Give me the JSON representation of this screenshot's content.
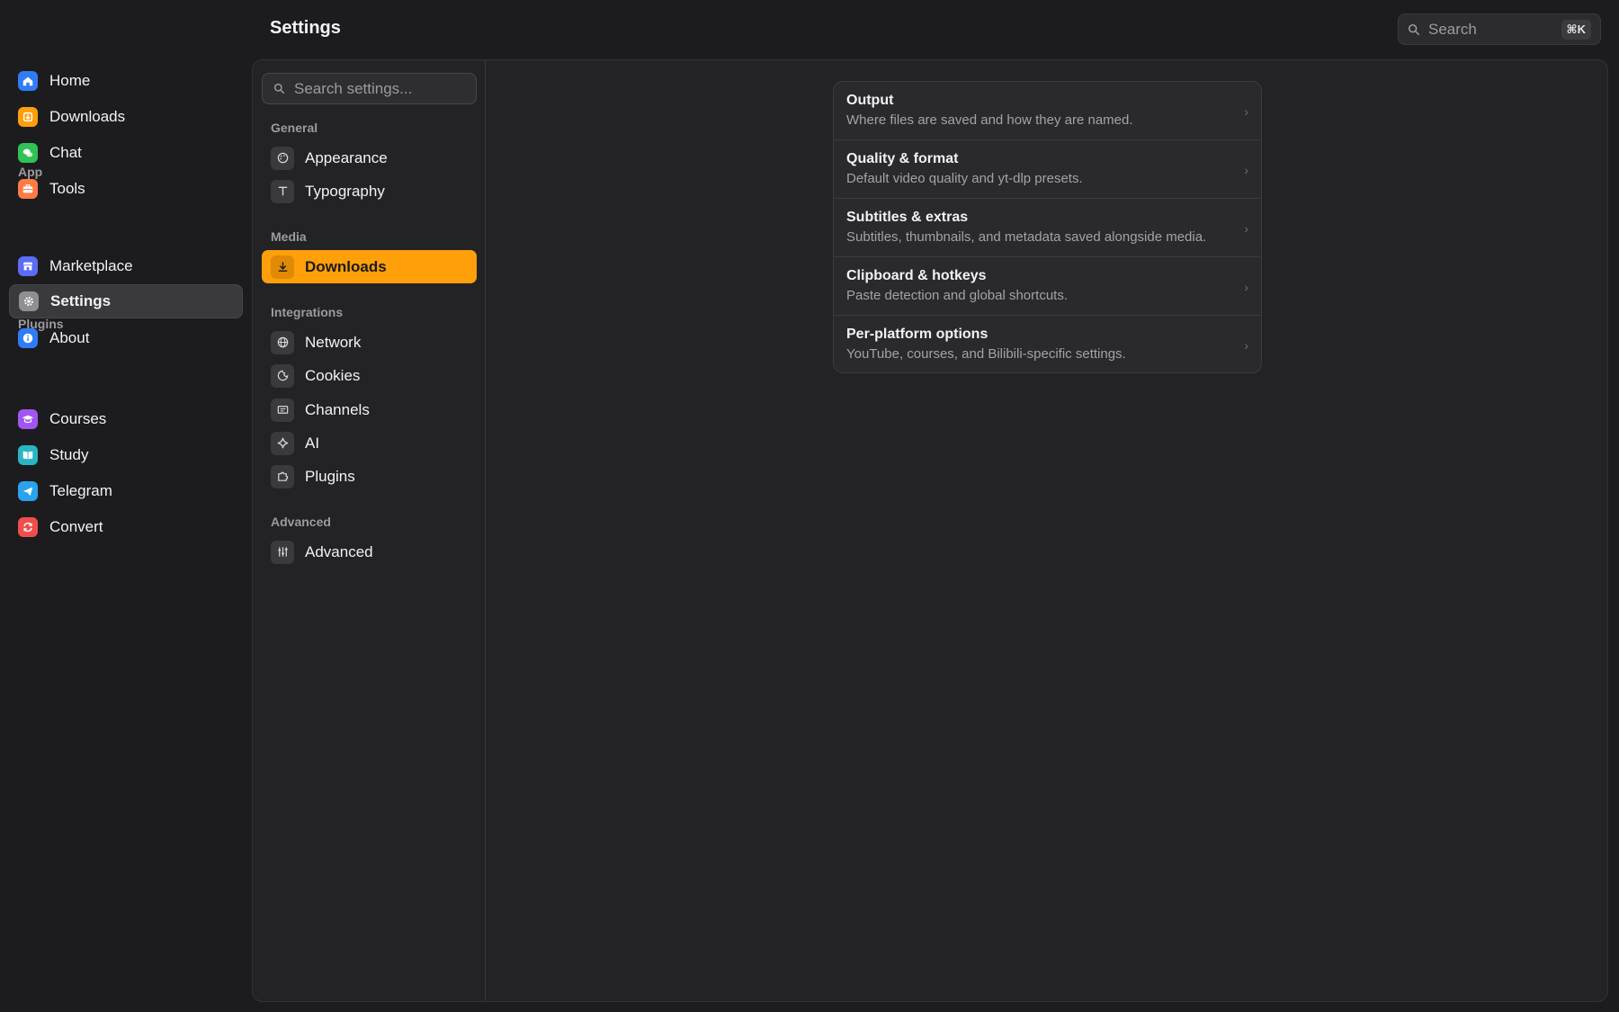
{
  "header": {
    "title": "Settings",
    "search_placeholder": "Search",
    "search_shortcut": "⌘K"
  },
  "app_sidebar": {
    "items": [
      {
        "label": "Home",
        "icon": "house-icon",
        "color": "#2f7cf6"
      },
      {
        "label": "Downloads",
        "icon": "download-box-icon",
        "color": "#ff9f0a"
      },
      {
        "label": "Chat",
        "icon": "chat-bubbles-icon",
        "color": "#30c254"
      },
      {
        "label": "Tools",
        "icon": "toolbox-icon",
        "color": "#ff7a45"
      }
    ],
    "app_label": "App",
    "app_items": [
      {
        "label": "Marketplace",
        "icon": "storefront-icon",
        "color": "#5b6cf5"
      },
      {
        "label": "Settings",
        "icon": "gear-icon",
        "color": "#8e8e93",
        "active": true
      },
      {
        "label": "About",
        "icon": "info-icon",
        "color": "#2f7cf6"
      }
    ],
    "plugins_label": "Plugins",
    "plugin_items": [
      {
        "label": "Courses",
        "icon": "graduation-cap-icon",
        "color": "#a256f0"
      },
      {
        "label": "Study",
        "icon": "book-icon",
        "color": "#2bb5c4"
      },
      {
        "label": "Telegram",
        "icon": "paper-plane-icon",
        "color": "#2aa3ef"
      },
      {
        "label": "Convert",
        "icon": "refresh-icon",
        "color": "#f04e4e"
      }
    ]
  },
  "settings_nav": {
    "search_placeholder": "Search settings...",
    "sections": {
      "general": "General",
      "media": "Media",
      "integrations": "Integrations",
      "advanced": "Advanced"
    },
    "items": {
      "appearance": "Appearance",
      "typography": "Typography",
      "downloads": "Downloads",
      "network": "Network",
      "cookies": "Cookies",
      "channels": "Channels",
      "ai": "AI",
      "plugins": "Plugins",
      "advanced": "Advanced"
    },
    "active_item": "Downloads",
    "accent_color": "#ff9f0a"
  },
  "downloads_card": {
    "rows": [
      {
        "title": "Output",
        "description": "Where files are saved and how they are named."
      },
      {
        "title": "Quality & format",
        "description": "Default video quality and yt-dlp presets."
      },
      {
        "title": "Subtitles & extras",
        "description": "Subtitles, thumbnails, and metadata saved alongside media."
      },
      {
        "title": "Clipboard & hotkeys",
        "description": "Paste detection and global shortcuts."
      },
      {
        "title": "Per-platform options",
        "description": "YouTube, courses, and Bilibili-specific settings."
      }
    ]
  }
}
